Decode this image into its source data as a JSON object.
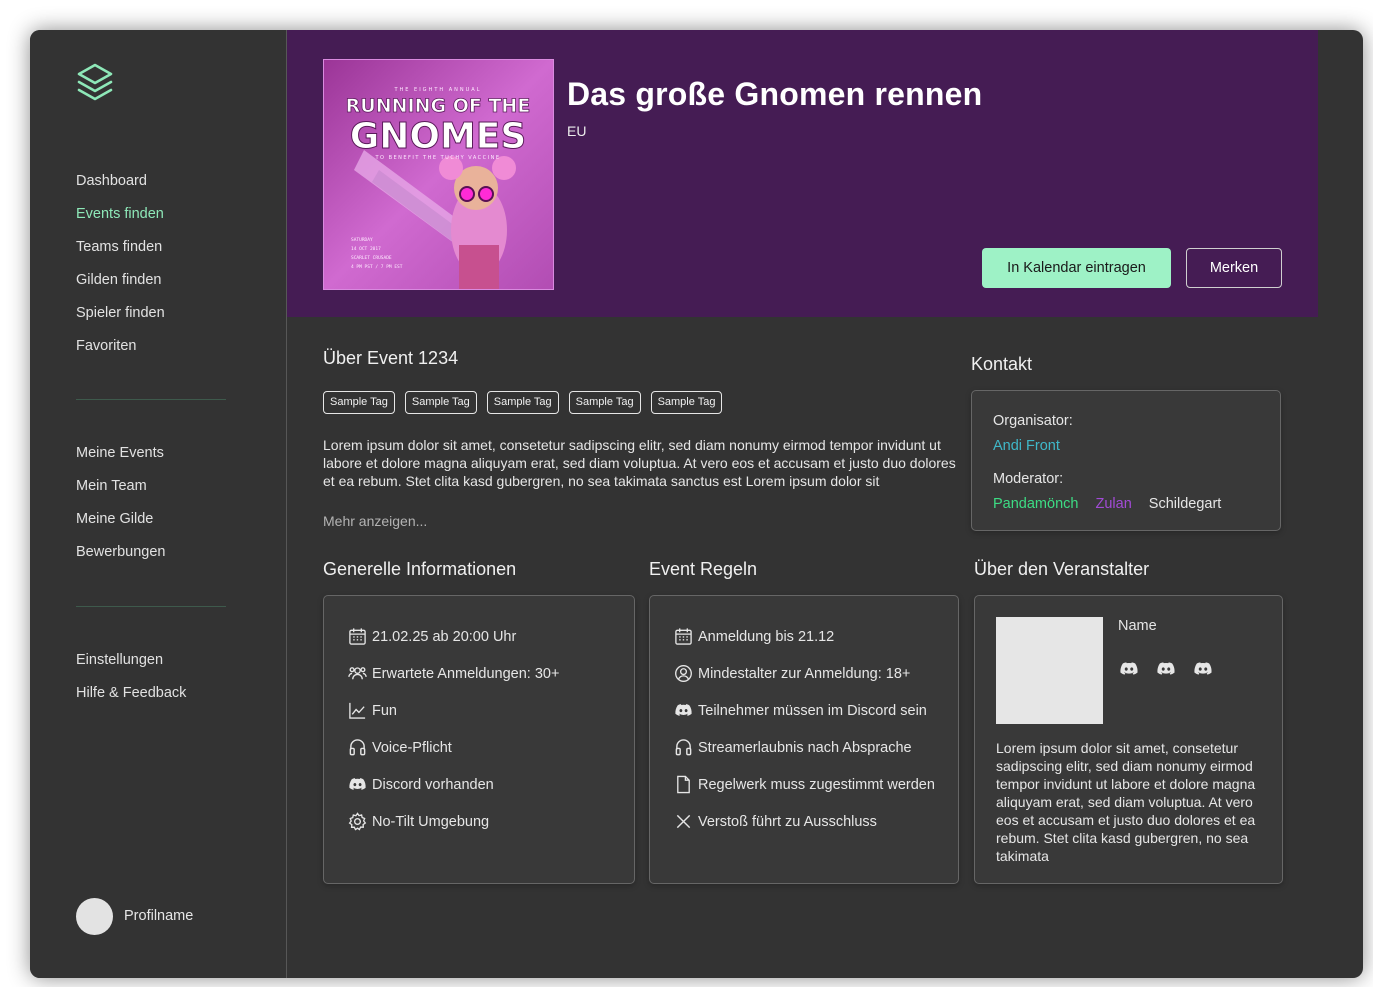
{
  "nav": {
    "primary": [
      {
        "label": "Dashboard",
        "active": false
      },
      {
        "label": "Events finden",
        "active": true
      },
      {
        "label": "Teams finden",
        "active": false
      },
      {
        "label": "Gilden finden",
        "active": false
      },
      {
        "label": "Spieler finden",
        "active": false
      },
      {
        "label": "Favoriten",
        "active": false
      }
    ],
    "secondary": [
      "Meine Events",
      "Mein Team",
      "Meine Gilde",
      "Bewerbungen"
    ],
    "tertiary": [
      "Einstellungen",
      "Hilfe & Feedback"
    ]
  },
  "profile": {
    "name": "Profilname"
  },
  "event": {
    "title": "Das große Gnomen rennen",
    "region": "EU",
    "cover": {
      "kicker": "THE EIGHTH ANNUAL",
      "title_line1": "RUNNING OF THE",
      "title_line2": "GNOMES",
      "subtitle": "TO BENEFIT THE TUCHY VACCINE",
      "details": [
        "SATURDAY",
        "14 OCT 2017",
        "SCARLET CRUSADE",
        "4 PM PST / 7 PM EST"
      ]
    },
    "actions": {
      "calendar": "In Kalendar eintragen",
      "save": "Merken"
    }
  },
  "about": {
    "title": "Über Event 1234",
    "tags": [
      "Sample Tag",
      "Sample Tag",
      "Sample Tag",
      "Sample Tag",
      "Sample Tag"
    ],
    "text": "Lorem ipsum dolor sit amet, consetetur sadipscing elitr, sed diam nonumy eirmod tempor invidunt ut labore et dolore magna aliquyam erat, sed diam voluptua. At vero eos et accusam et justo duo dolores et ea rebum. Stet clita kasd gubergren, no sea takimata sanctus est Lorem ipsum dolor sit",
    "more": "Mehr anzeigen..."
  },
  "contact": {
    "title": "Kontakt",
    "organizer_label": "Organisator:",
    "organizer": "Andi Front",
    "moderator_label": "Moderator:",
    "moderators": [
      {
        "name": "Pandamönch",
        "color": "#3ddc84"
      },
      {
        "name": "Zulan",
        "color": "#a24bd6"
      },
      {
        "name": "Schildegart",
        "color": "#e6e6e6"
      }
    ],
    "organizer_color": "#3fb8c9"
  },
  "general": {
    "title": "Generelle Informationen",
    "items": [
      {
        "icon": "calendar-icon",
        "text": "21.02.25 ab 20:00 Uhr"
      },
      {
        "icon": "users-icon",
        "text": "Erwartete Anmeldungen: 30+"
      },
      {
        "icon": "chart-line-icon",
        "text": "Fun"
      },
      {
        "icon": "headset-icon",
        "text": "Voice-Pflicht"
      },
      {
        "icon": "discord-icon",
        "text": "Discord vorhanden"
      },
      {
        "icon": "settings-icon",
        "text": "No-Tilt Umgebung"
      }
    ]
  },
  "rules": {
    "title": "Event Regeln",
    "items": [
      {
        "icon": "calendar-icon",
        "text": "Anmeldung bis 21.12"
      },
      {
        "icon": "user-circle-icon",
        "text": "Mindestalter zur Anmeldung: 18+"
      },
      {
        "icon": "discord-icon",
        "text": "Teilnehmer müssen im Discord sein"
      },
      {
        "icon": "headset-icon",
        "text": "Streamerlaubnis nach Absprache"
      },
      {
        "icon": "document-icon",
        "text": "Regelwerk muss zugestimmt werden"
      },
      {
        "icon": "close-icon",
        "text": "Verstoß führt zu Ausschluss"
      }
    ]
  },
  "host": {
    "title": "Über den Veranstalter",
    "name": "Name",
    "socials": [
      "discord-icon",
      "discord-icon",
      "discord-icon"
    ],
    "text": "Lorem ipsum dolor sit amet, consetetur sadipscing elitr, sed diam nonumy eirmod tempor invidunt ut labore et dolore magna aliquyam erat, sed diam voluptua. At vero eos et accusam et justo duo dolores et ea rebum. Stet clita kasd gubergren, no sea takimata"
  },
  "colors": {
    "accent": "#9ef2c6",
    "hero_bg": "#451c54",
    "background": "#333333",
    "card": "#393939"
  }
}
